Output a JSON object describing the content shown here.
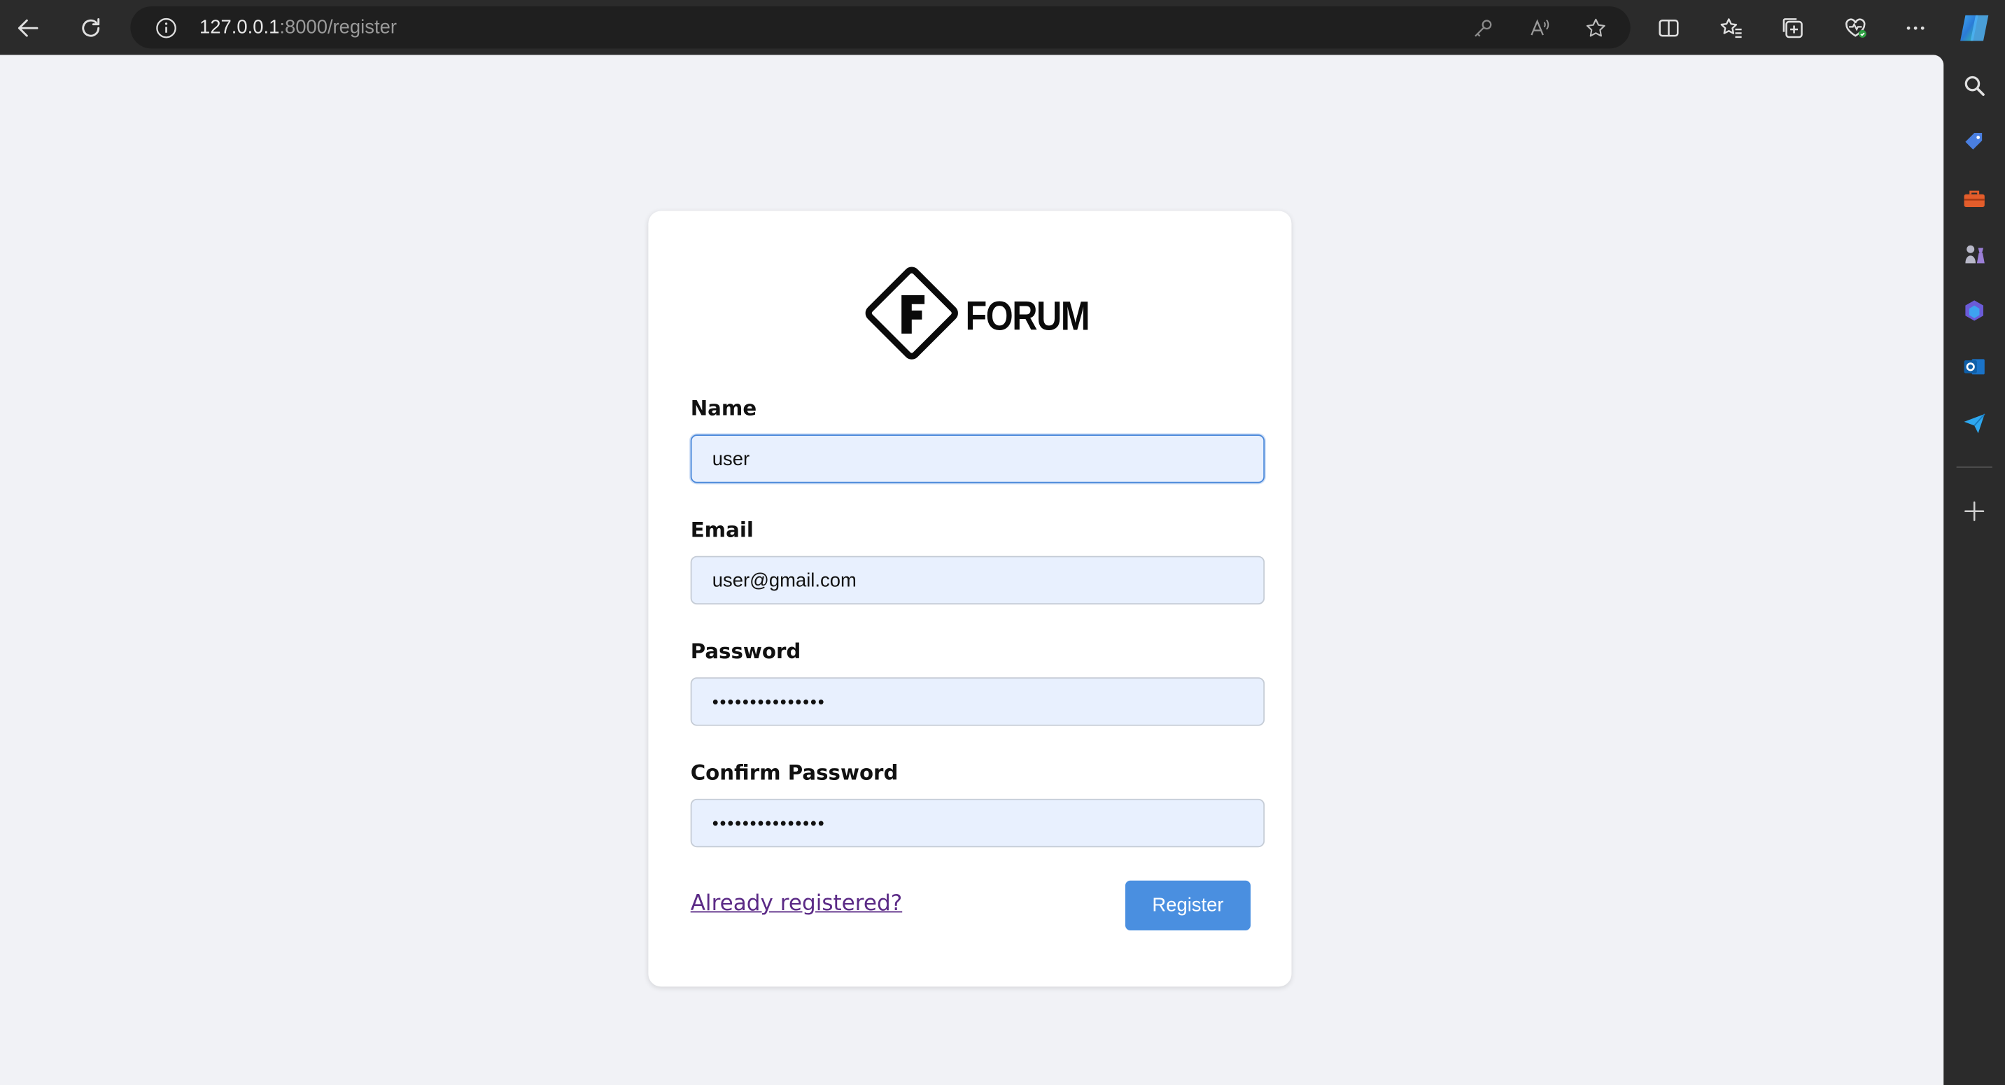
{
  "browser": {
    "url_host": "127.0.0.1",
    "url_path": ":8000/register"
  },
  "page": {
    "brand_name": "FORUM",
    "logo_letter": "F",
    "fields": {
      "name_label": "Name",
      "name_value": "user",
      "email_label": "Email",
      "email_value": "user@gmail.com",
      "password_label": "Password",
      "password_value": "•••••••••••••••",
      "confirm_label": "Confirm Password",
      "confirm_value": "•••••••••••••••"
    },
    "login_link": "Already registered?",
    "register_button": "Register"
  },
  "colors": {
    "page_bg": "#f1f2f6",
    "input_bg": "#e8f0fe",
    "focus_border": "#4a88da",
    "button_bg": "#4a8fe0",
    "link": "#5b2a86"
  }
}
